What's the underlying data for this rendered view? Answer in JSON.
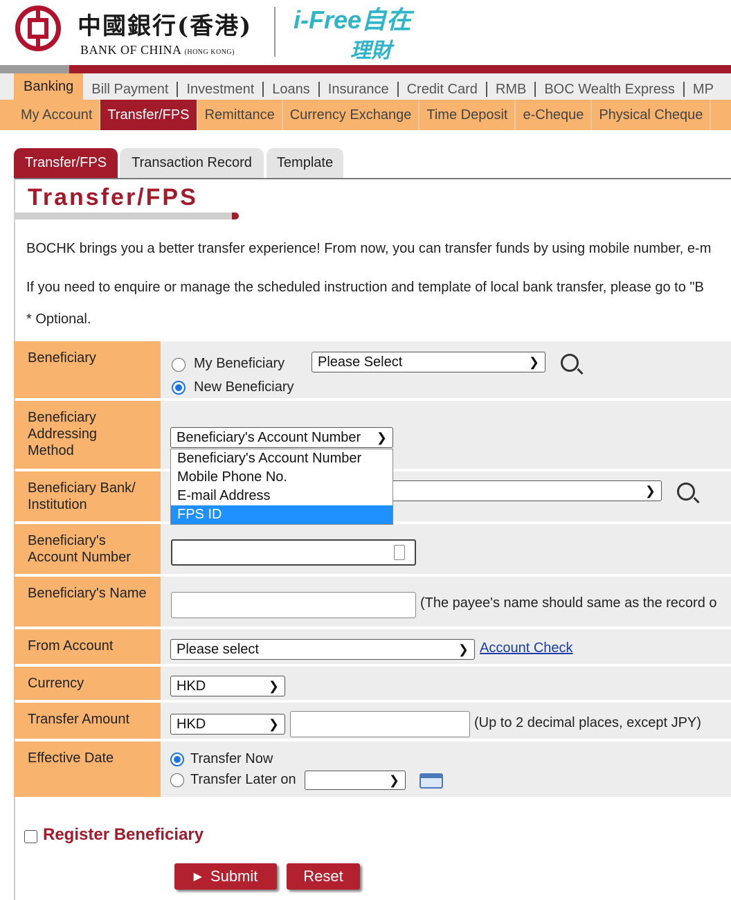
{
  "header": {
    "bank_name_cn": "中國銀行(香港)",
    "bank_name_en": "BANK OF CHINA",
    "bank_name_en_suffix": "(HONG KONG)",
    "brand": "i-Free",
    "brand_cn_top": "自在",
    "brand_cn_bottom": "理財"
  },
  "nav_primary": [
    "Banking",
    "Bill Payment",
    "Investment",
    "Loans",
    "Insurance",
    "Credit Card",
    "RMB",
    "BOC Wealth Express",
    "MP"
  ],
  "nav_primary_active": "Banking",
  "nav_secondary": [
    "My Account",
    "Transfer/FPS",
    "Remittance",
    "Currency Exchange",
    "Time Deposit",
    "e-Cheque",
    "Physical Cheque"
  ],
  "nav_secondary_active": "Transfer/FPS",
  "tabs": [
    "Transfer/FPS",
    "Transaction Record",
    "Template"
  ],
  "page_title": "Transfer/FPS",
  "intro": {
    "line1": "BOCHK brings you a better transfer experience! From now, you can transfer funds by using mobile number, e-m",
    "line2": "If you need to enquire or manage the scheduled instruction and template of local bank transfer, please go to \"B",
    "optional_note": "* Optional."
  },
  "form": {
    "beneficiary": {
      "label": "Beneficiary",
      "option_my": "My Beneficiary",
      "option_new": "New Beneficiary",
      "selected": "New Beneficiary",
      "select_value": "Please Select"
    },
    "addressing_method": {
      "label": "Beneficiary Addressing Method",
      "value": "Beneficiary's Account Number",
      "options": [
        "Beneficiary's Account Number",
        "Mobile Phone No.",
        "E-mail Address",
        "FPS ID"
      ],
      "highlighted": "FPS ID"
    },
    "bank": {
      "label": "Beneficiary Bank/ Institution",
      "value": ""
    },
    "account_number": {
      "label": "Beneficiary's Account Number",
      "value": ""
    },
    "name": {
      "label": "Beneficiary's Name",
      "value": "",
      "hint": "(The payee's name should same as the record o"
    },
    "from_account": {
      "label": "From Account",
      "value": "Please select",
      "link": "Account Check"
    },
    "currency": {
      "label": "Currency",
      "value": "HKD"
    },
    "transfer_amount": {
      "label": "Transfer Amount",
      "currency": "HKD",
      "value": "",
      "hint": "(Up to 2 decimal places, except JPY)"
    },
    "effective_date": {
      "label": "Effective Date",
      "option_now": "Transfer Now",
      "option_later": "Transfer Later on",
      "selected": "Transfer Now",
      "date_value": ""
    }
  },
  "register_beneficiary": {
    "label": "Register Beneficiary",
    "checked": false
  },
  "buttons": {
    "submit": "Submit",
    "reset": "Reset"
  },
  "colors": {
    "brand_red": "#a31a2a",
    "orange": "#f8b46e",
    "teal": "#2fb4c8",
    "highlight_blue": "#1e90ff"
  }
}
